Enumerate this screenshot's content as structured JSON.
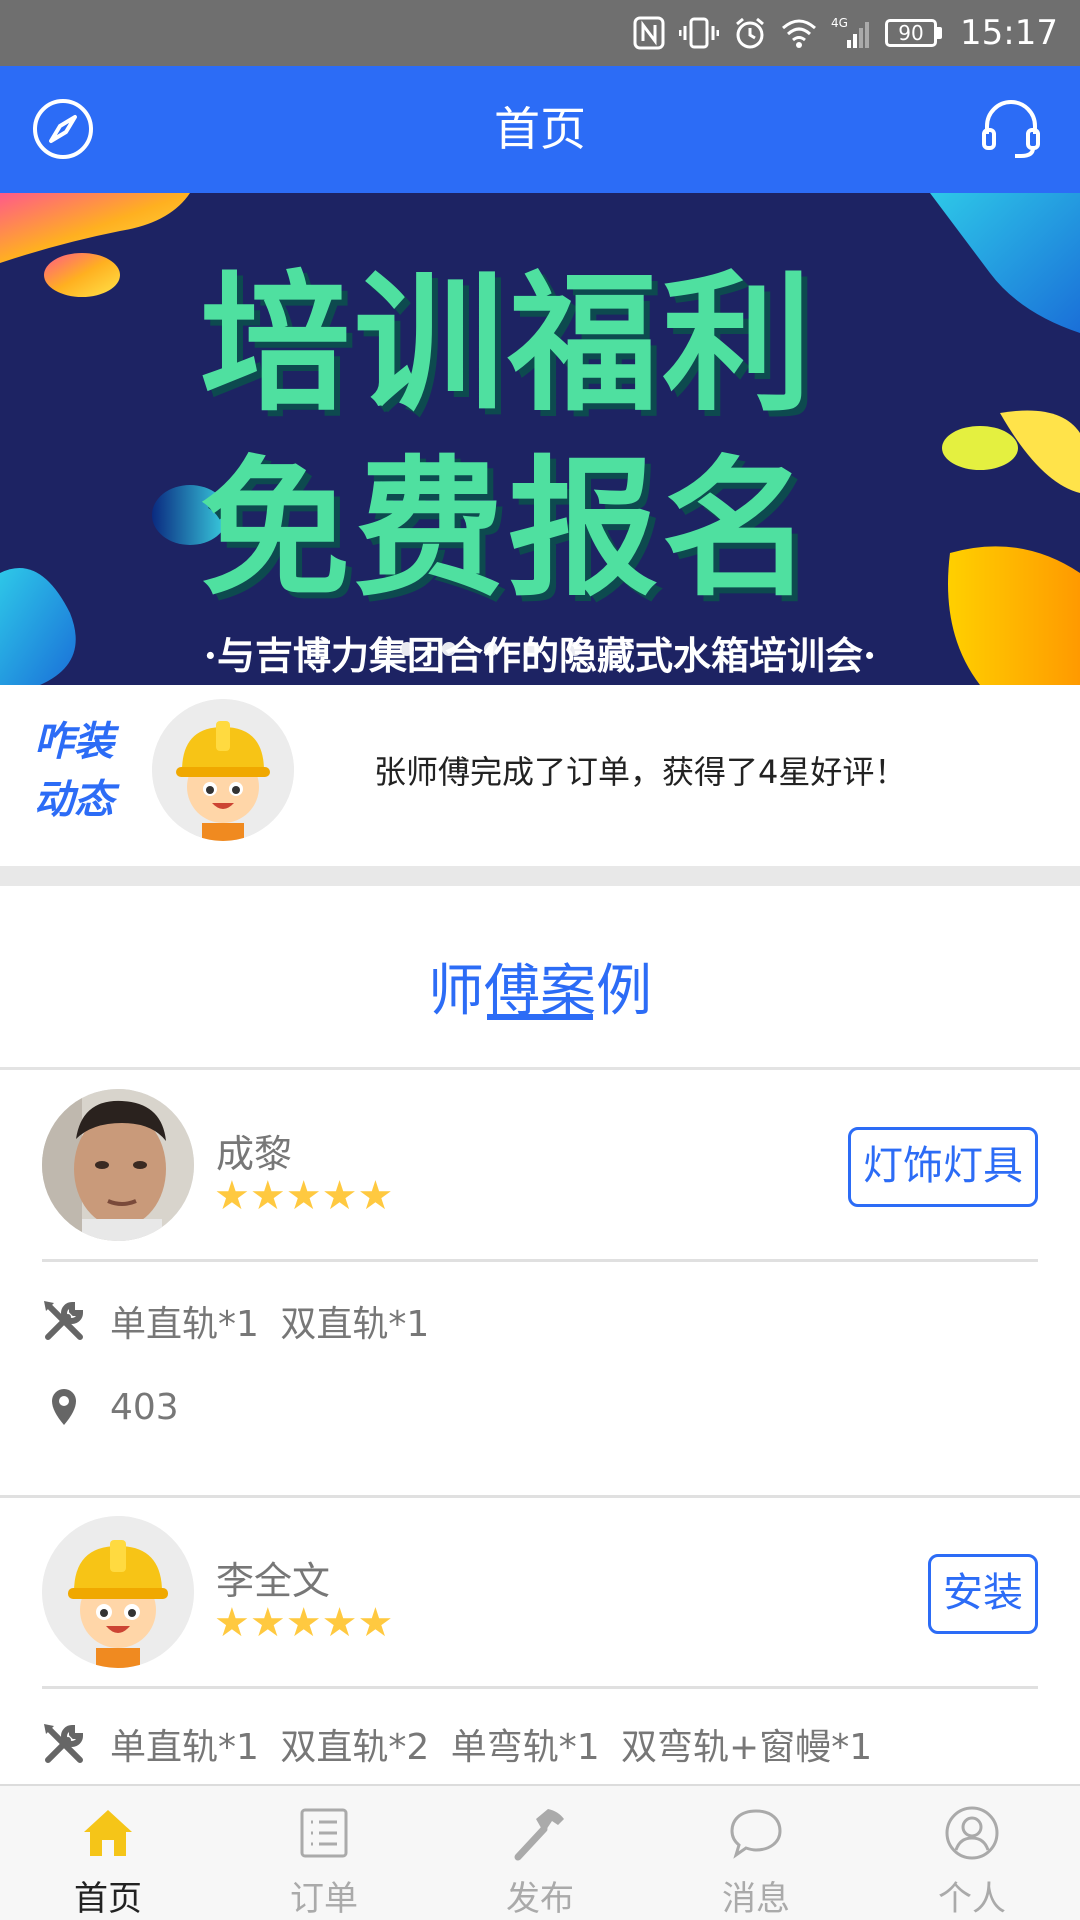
{
  "status_bar": {
    "battery": "90",
    "time": "15:17",
    "network": "4G"
  },
  "header": {
    "title": "首页",
    "left_icon": "compass-icon",
    "right_icon": "headset-icon"
  },
  "banner": {
    "line1": "培训福利",
    "line2": "免费报名",
    "subtitle": "·与吉博力集团合作的隐藏式水箱培训会·"
  },
  "ticker": {
    "label_line1": "咋装",
    "label_line2": "动态",
    "message": "张师傅完成了订单，获得了4星好评！"
  },
  "section": {
    "title": "师傅案例"
  },
  "cases": [
    {
      "name": "成黎",
      "stars": "★★★★★",
      "rating": 5,
      "tag": "灯饰灯具",
      "items": "单直轨*1 双直轨*1",
      "location": "403"
    },
    {
      "name": "李全文",
      "stars": "★★★★★",
      "rating": 5,
      "tag": "安装",
      "items": "单直轨*1 双直轨*2 单弯轨*1 双弯轨+窗幔*1"
    }
  ],
  "tabs": [
    {
      "label": "首页",
      "icon": "home-icon",
      "active": true
    },
    {
      "label": "订单",
      "icon": "list-icon",
      "active": false
    },
    {
      "label": "发布",
      "icon": "hammer-icon",
      "active": false
    },
    {
      "label": "消息",
      "icon": "chat-icon",
      "active": false
    },
    {
      "label": "个人",
      "icon": "user-icon",
      "active": false
    }
  ],
  "colors": {
    "primary": "#2c6cf6",
    "star": "#ffc940",
    "active_tab_icon": "#f5c518"
  }
}
